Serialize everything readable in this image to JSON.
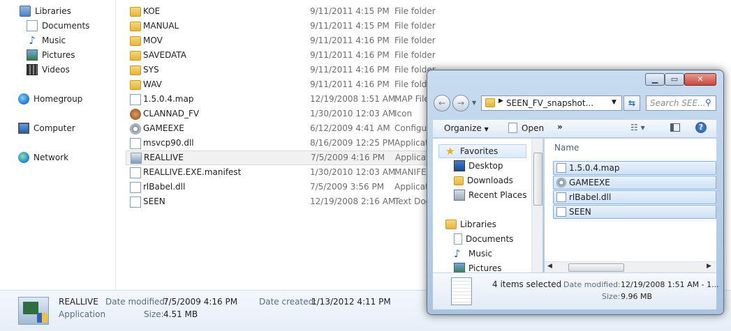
{
  "nav": {
    "items": [
      {
        "label": "Libraries",
        "icon": "libraries-icon"
      },
      {
        "label": "Documents",
        "icon": "documents-icon"
      },
      {
        "label": "Music",
        "icon": "music-icon"
      },
      {
        "label": "Pictures",
        "icon": "pictures-icon"
      },
      {
        "label": "Videos",
        "icon": "videos-icon"
      },
      {
        "label": "Homegroup",
        "icon": "homegroup-icon"
      },
      {
        "label": "Computer",
        "icon": "computer-icon"
      },
      {
        "label": "Network",
        "icon": "network-icon"
      }
    ]
  },
  "files": [
    {
      "name": "KOE",
      "date": "9/11/2011 4:15 PM",
      "type": "File folder",
      "icon": "folder-icon"
    },
    {
      "name": "MANUAL",
      "date": "9/11/2011 4:15 PM",
      "type": "File folder",
      "icon": "folder-icon"
    },
    {
      "name": "MOV",
      "date": "9/11/2011 4:16 PM",
      "type": "File folder",
      "icon": "folder-icon"
    },
    {
      "name": "SAVEDATA",
      "date": "9/11/2011 4:16 PM",
      "type": "File folder",
      "icon": "folder-icon"
    },
    {
      "name": "SYS",
      "date": "9/11/2011 4:16 PM",
      "type": "File folder",
      "icon": "folder-icon"
    },
    {
      "name": "WAV",
      "date": "9/11/2011 4:16 PM",
      "type": "File folder",
      "icon": "folder-icon"
    },
    {
      "name": "1.5.0.4.map",
      "date": "12/19/2008 1:51 AM",
      "type": "MAP File",
      "icon": "file-icon"
    },
    {
      "name": "CLANNAD_FV",
      "date": "1/30/2010 12:03 AM",
      "type": "Icon",
      "icon": "icon-file-icon"
    },
    {
      "name": "GAMEEXE",
      "date": "6/12/2009 4:41 AM",
      "type": "Configuration settings",
      "icon": "settings-file-icon"
    },
    {
      "name": "msvcp90.dll",
      "date": "8/16/2009 12:25 PM",
      "type": "Application extension",
      "icon": "dll-icon"
    },
    {
      "name": "REALLIVE",
      "date": "7/5/2009 4:16 PM",
      "type": "Application",
      "icon": "app-icon"
    },
    {
      "name": "REALLIVE.EXE.manifest",
      "date": "1/30/2010 12:03 AM",
      "type": "MANIFEST File",
      "icon": "file-icon"
    },
    {
      "name": "rlBabel.dll",
      "date": "7/5/2009 3:56 PM",
      "type": "Application extension",
      "icon": "dll-icon"
    },
    {
      "name": "SEEN",
      "date": "12/19/2008 2:16 AM",
      "type": "Text Document",
      "icon": "text-file-icon"
    }
  ],
  "details": {
    "name": "REALLIVE",
    "kind": "Application",
    "modified_label": "Date modified:",
    "modified": "7/5/2009 4:16 PM",
    "size_label": "Size:",
    "size": "4.51 MB",
    "created_label": "Date created:",
    "created": "1/13/2012 4:11 PM"
  },
  "window": {
    "address": "SEEN_FV_snapshot...",
    "search_placeholder": "Search SEE...",
    "organize": "Organize",
    "open": "Open",
    "more": "»",
    "column_name": "Name",
    "favorites": "Favorites",
    "nav_items": [
      {
        "label": "Desktop",
        "icon": "desktop-icon"
      },
      {
        "label": "Downloads",
        "icon": "downloads-icon"
      },
      {
        "label": "Recent Places",
        "icon": "recent-places-icon"
      }
    ],
    "libraries": "Libraries",
    "lib_items": [
      {
        "label": "Documents",
        "icon": "documents-icon"
      },
      {
        "label": "Music",
        "icon": "music-icon"
      },
      {
        "label": "Pictures",
        "icon": "pictures-icon"
      }
    ],
    "files": [
      {
        "name": "1.5.0.4.map",
        "icon": "file-icon"
      },
      {
        "name": "GAMEEXE",
        "icon": "settings-file-icon"
      },
      {
        "name": "rlBabel.dll",
        "icon": "dll-icon"
      },
      {
        "name": "SEEN",
        "icon": "text-file-icon"
      }
    ],
    "status": "4 items selected",
    "modified_label": "Date modified:",
    "modified": "12/19/2008 1:51 AM - 1...",
    "size_label": "Size:",
    "size": "9.96 MB"
  },
  "colors": {
    "accent": "#3399ff",
    "selection": "#cce3f8",
    "window_frame": "#a9c4e0",
    "close_button": "#c9463d"
  }
}
